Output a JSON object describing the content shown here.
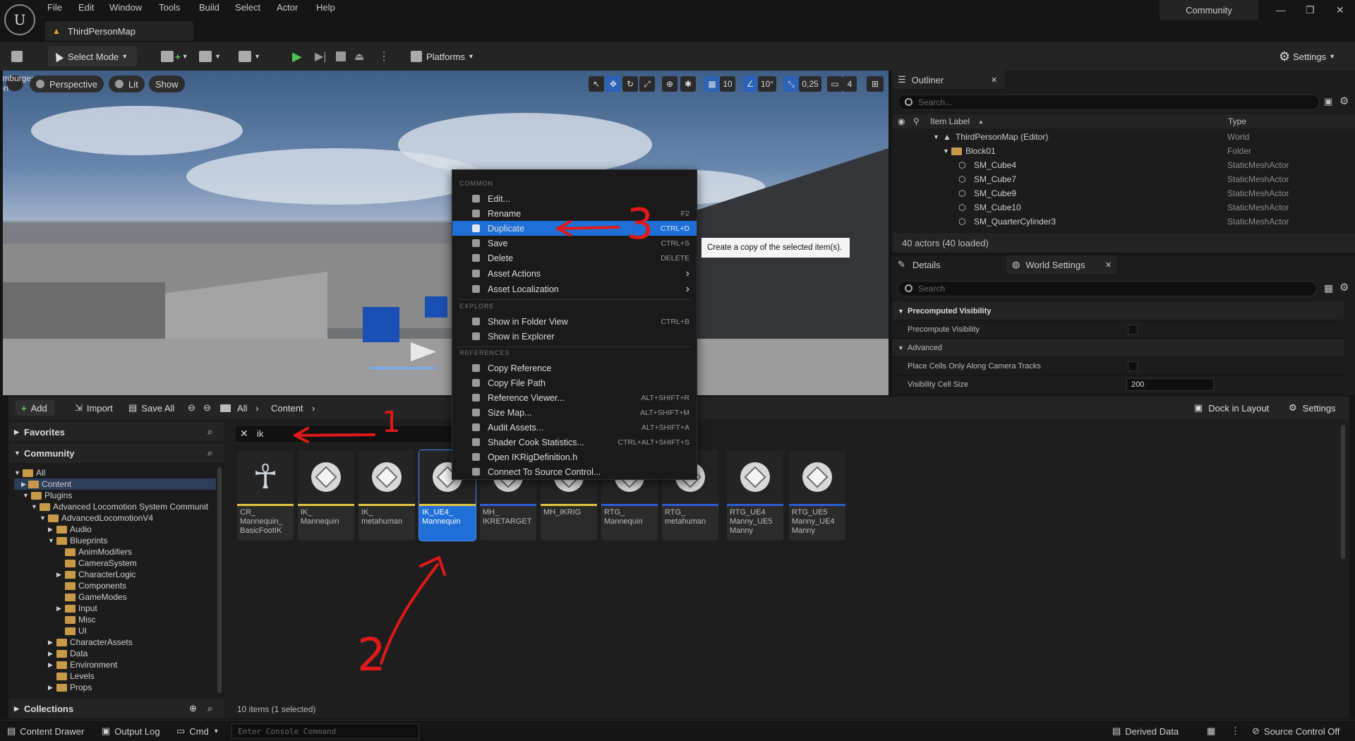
{
  "menu": [
    "File",
    "Edit",
    "Window",
    "Tools",
    "Build",
    "Select",
    "Actor",
    "Help"
  ],
  "map_tab": "ThirdPersonMap",
  "community_tab": "Community",
  "toolbar": {
    "select_mode": "Select Mode",
    "platforms": "Platforms",
    "settings": "Settings"
  },
  "viewport": {
    "menu_icon": "hamburger-icon",
    "perspective": "Perspective",
    "lit": "Lit",
    "show": "Show",
    "grid_snap": "10",
    "angle_snap": "10°",
    "scale_snap": "0,25",
    "camera_speed": "4"
  },
  "outliner": {
    "tab": "Outliner",
    "search_placeholder": "Search...",
    "col_label": "Item Label",
    "col_type": "Type",
    "rows": [
      {
        "label": "ThirdPersonMap (Editor)",
        "type": "World"
      },
      {
        "label": "Block01",
        "type": "Folder"
      },
      {
        "label": "SM_Cube4",
        "type": "StaticMeshActor"
      },
      {
        "label": "SM_Cube7",
        "type": "StaticMeshActor"
      },
      {
        "label": "SM_Cube9",
        "type": "StaticMeshActor"
      },
      {
        "label": "SM_Cube10",
        "type": "StaticMeshActor"
      },
      {
        "label": "SM_QuarterCylinder3",
        "type": "StaticMeshActor"
      }
    ],
    "count": "40 actors (40 loaded)"
  },
  "details": {
    "tab_details": "Details",
    "tab_world": "World Settings",
    "search_placeholder": "Search",
    "rows": [
      {
        "label": "Precomputed Visibility"
      },
      {
        "label": "Precompute Visibility"
      },
      {
        "label": "Advanced"
      },
      {
        "label": "Place Cells Only Along Camera Tracks"
      },
      {
        "label": "Visibility Cell Size",
        "value": "200"
      }
    ]
  },
  "content_browser": {
    "add": "Add",
    "import": "Import",
    "save_all": "Save All",
    "path": [
      "All",
      "Content"
    ],
    "dock": "Dock in Layout",
    "settings": "Settings",
    "favorites": "Favorites",
    "community": "Community",
    "collections": "Collections",
    "filter_text": "ik",
    "tree": [
      "All",
      "Content",
      "Plugins",
      "Advanced Locomotion System Communit",
      "AdvancedLocomotionV4",
      "Audio",
      "Blueprints",
      "AnimModifiers",
      "CameraSystem",
      "CharacterLogic",
      "Components",
      "GameModes",
      "Input",
      "Misc",
      "UI",
      "CharacterAssets",
      "Data",
      "Environment",
      "Levels",
      "Props"
    ],
    "assets": [
      {
        "l1": "CR_",
        "l2": "Mannequin_",
        "l3": "BasicFootIK",
        "band": "#e0c340"
      },
      {
        "l1": "IK_",
        "l2": "Mannequin",
        "l3": "",
        "band": "#e0c340"
      },
      {
        "l1": "IK_",
        "l2": "metahuman",
        "l3": "",
        "band": "#e0c340"
      },
      {
        "l1": "IK_UE4_",
        "l2": "Mannequin",
        "l3": "",
        "band": "#e0c340"
      },
      {
        "l1": "MH_",
        "l2": "IKRETARGET",
        "l3": "",
        "band": "#2a5fd0"
      },
      {
        "l1": "MH_IKRIG",
        "l2": "",
        "l3": "",
        "band": "#e0c340"
      },
      {
        "l1": "RTG_",
        "l2": "Mannequin",
        "l3": "",
        "band": "#2a5fd0"
      },
      {
        "l1": "RTG_",
        "l2": "metahuman",
        "l3": "",
        "band": "#2a5fd0"
      },
      {
        "l1": "RTG_UE4",
        "l2": "Manny_UE5",
        "l3": "Manny",
        "band": "#2a5fd0"
      },
      {
        "l1": "RTG_UE5",
        "l2": "Manny_UE4",
        "l3": "Manny",
        "band": "#2a5fd0"
      }
    ],
    "item_count": "10 items (1 selected)"
  },
  "context_menu": {
    "headers": [
      "COMMON",
      "EXPLORE",
      "REFERENCES"
    ],
    "items": [
      {
        "label": "Edit...",
        "shortcut": ""
      },
      {
        "label": "Rename",
        "shortcut": "F2"
      },
      {
        "label": "Duplicate",
        "shortcut": "CTRL+D"
      },
      {
        "label": "Save",
        "shortcut": "CTRL+S"
      },
      {
        "label": "Delete",
        "shortcut": "DELETE"
      },
      {
        "label": "Asset Actions",
        "shortcut": "›"
      },
      {
        "label": "Asset Localization",
        "shortcut": "›"
      },
      {
        "label": "Show in Folder View",
        "shortcut": "CTRL+B"
      },
      {
        "label": "Show in Explorer",
        "shortcut": ""
      },
      {
        "label": "Copy Reference",
        "shortcut": ""
      },
      {
        "label": "Copy File Path",
        "shortcut": ""
      },
      {
        "label": "Reference Viewer...",
        "shortcut": "ALT+SHIFT+R"
      },
      {
        "label": "Size Map...",
        "shortcut": "ALT+SHIFT+M"
      },
      {
        "label": "Audit Assets...",
        "shortcut": "ALT+SHIFT+A"
      },
      {
        "label": "Shader Cook Statistics...",
        "shortcut": "CTRL+ALT+SHIFT+S"
      },
      {
        "label": "Open IKRigDefinition.h",
        "shortcut": ""
      },
      {
        "label": "Connect To Source Control...",
        "shortcut": ""
      }
    ],
    "tooltip": "Create a copy of the selected item(s)."
  },
  "annotations": [
    "1",
    "2",
    "3"
  ],
  "statusbar": {
    "drawer": "Content Drawer",
    "output": "Output Log",
    "cmd": "Cmd",
    "console_placeholder": "Enter Console Command",
    "derived": "Derived Data",
    "source": "Source Control Off"
  }
}
